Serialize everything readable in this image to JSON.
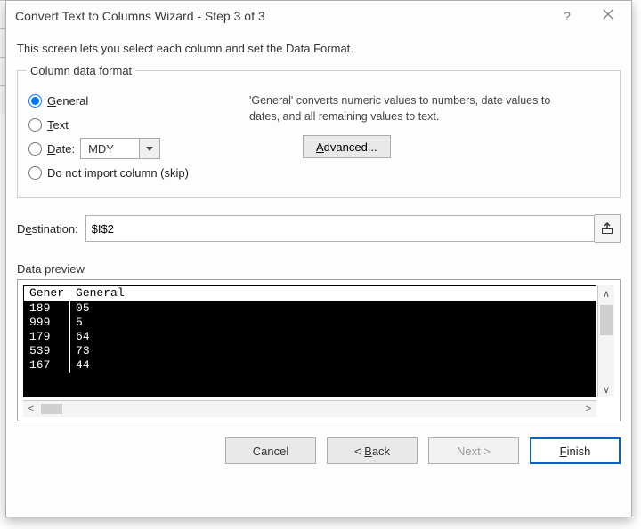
{
  "title": "Convert Text to Columns Wizard - Step 3 of 3",
  "intro": "This screen lets you select each column and set the Data Format.",
  "format_legend": "Column data format",
  "radios": {
    "general": "General",
    "text": "Text",
    "date": "Date:",
    "skip": "Do not import column (skip)"
  },
  "date_value": "MDY",
  "hint": "'General' converts numeric values to numbers, date values to dates, and all remaining values to text.",
  "advanced_label": "Advanced...",
  "destination_label": "Destination:",
  "destination_value": "$I$2",
  "preview_label": "Data preview",
  "preview": {
    "header": [
      "General",
      "General"
    ],
    "header_display": [
      "Gener",
      "General"
    ],
    "rows": [
      [
        "189",
        "05"
      ],
      [
        "999",
        "5"
      ],
      [
        "179",
        "64"
      ],
      [
        "539",
        "73"
      ],
      [
        "167",
        "44"
      ]
    ]
  },
  "buttons": {
    "cancel": "Cancel",
    "back": "Back",
    "next": "Next >",
    "finish": "Finish"
  }
}
